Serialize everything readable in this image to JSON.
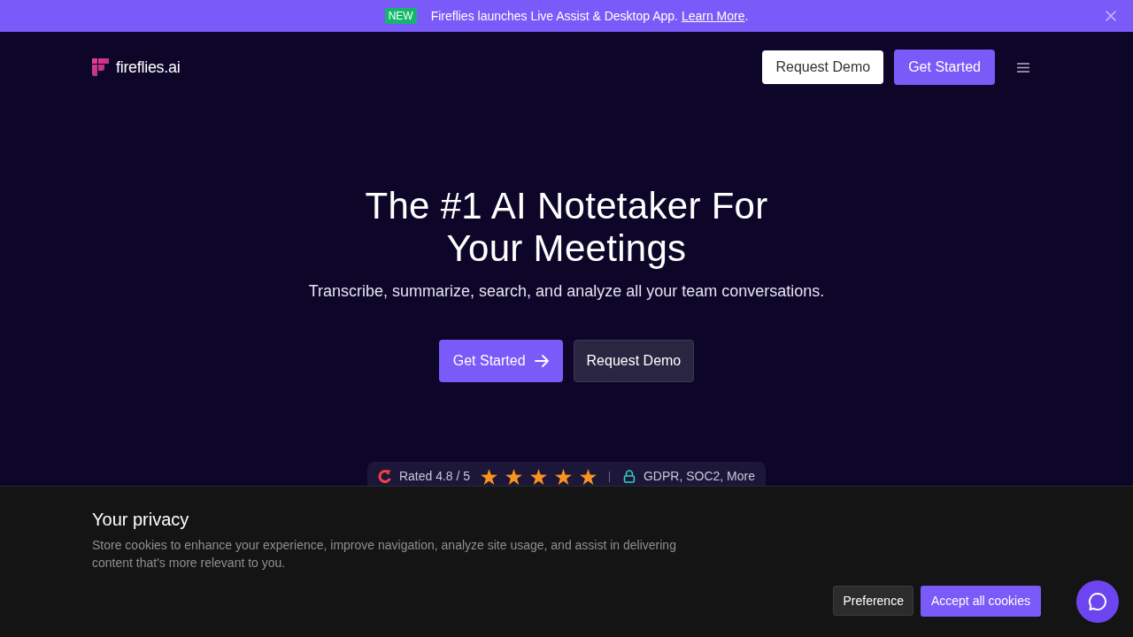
{
  "announcement": {
    "badge": "NEW",
    "text": "Fireflies launches Live Assist & Desktop App. ",
    "link": "Learn More",
    "trailing": "."
  },
  "nav": {
    "logo": "fireflies.ai",
    "buttons": [
      {
        "label": "Request Demo",
        "kind": "secondary"
      },
      {
        "label": "Get Started",
        "kind": "primary"
      }
    ]
  },
  "hero": {
    "title": "The #1 AI Notetaker For Your Meetings",
    "subtitle": "Transcribe, summarize, search, and analyze all your team conversations.",
    "buttons": [
      {
        "label": "Get Started",
        "kind": "primary",
        "arrow": true
      },
      {
        "label": "Request Demo",
        "kind": "secondary",
        "arrow": false
      }
    ]
  },
  "rating": {
    "text": "Rated 4.8 / 5",
    "stars": 5,
    "compliance": "GDPR, SOC2, More"
  },
  "cookie_banner": {
    "title": "Your privacy",
    "description": "Store cookies to enhance your experience, improve navigation, analyze site usage, and assist in delivering content that's more relevant to you.",
    "buttons": [
      {
        "label": "Preference",
        "kind": "secondary"
      },
      {
        "label": "Accept all cookies",
        "kind": "primary"
      }
    ]
  }
}
